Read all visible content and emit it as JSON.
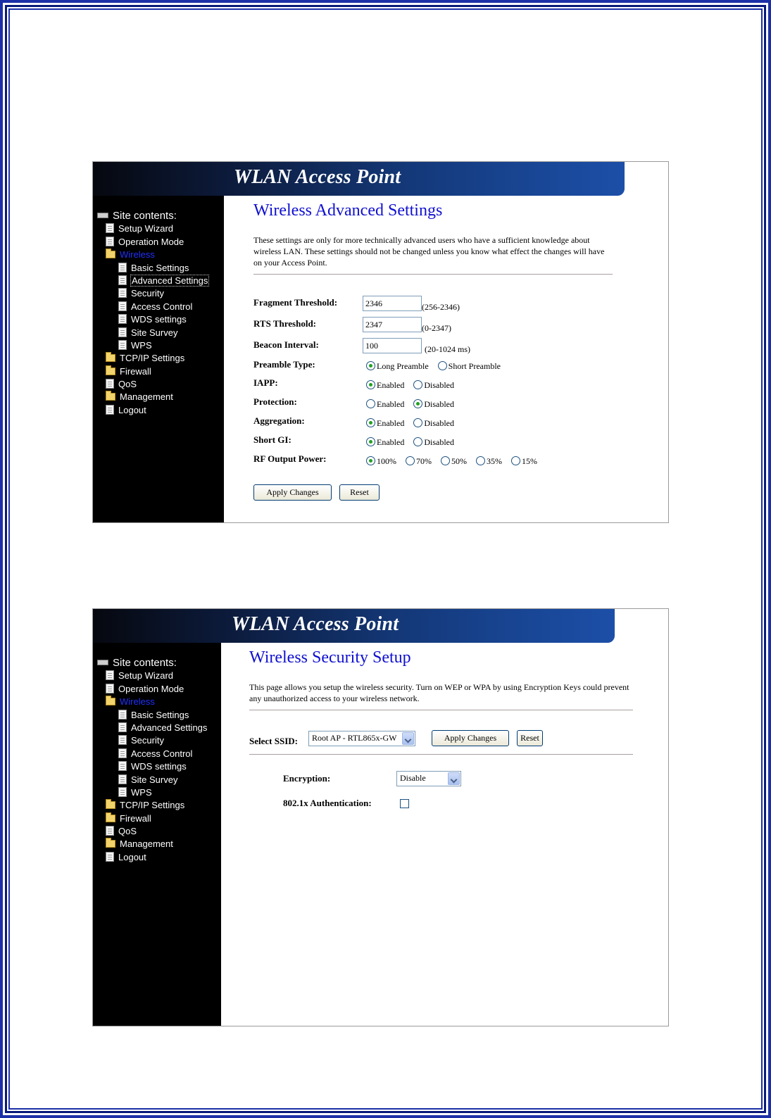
{
  "banner": {
    "title": "WLAN Access Point"
  },
  "sidebar": {
    "title": "Site contents:",
    "items": [
      {
        "label": "Setup Wizard",
        "icon": "document-icon",
        "level": 1
      },
      {
        "label": "Operation Mode",
        "icon": "document-icon",
        "level": 1
      },
      {
        "label": "Wireless",
        "icon": "open-folder-icon",
        "level": 1,
        "active": true
      },
      {
        "label": "Basic Settings",
        "icon": "document-icon",
        "level": 2
      },
      {
        "label": "Advanced Settings",
        "icon": "document-icon",
        "level": 2
      },
      {
        "label": "Security",
        "icon": "document-icon",
        "level": 2
      },
      {
        "label": "Access Control",
        "icon": "document-icon",
        "level": 2
      },
      {
        "label": "WDS settings",
        "icon": "document-icon",
        "level": 2
      },
      {
        "label": "Site Survey",
        "icon": "document-icon",
        "level": 2
      },
      {
        "label": "WPS",
        "icon": "document-icon",
        "level": 2
      },
      {
        "label": "TCP/IP Settings",
        "icon": "folder-icon",
        "level": 1
      },
      {
        "label": "Firewall",
        "icon": "folder-icon",
        "level": 1
      },
      {
        "label": "QoS",
        "icon": "document-icon",
        "level": 1
      },
      {
        "label": "Management",
        "icon": "folder-icon",
        "level": 1
      },
      {
        "label": "Logout",
        "icon": "document-icon",
        "level": 1
      }
    ]
  },
  "advanced": {
    "heading": "Wireless Advanced Settings",
    "description": "These settings are only for more technically advanced users who have a sufficient knowledge about wireless LAN. These settings should not be changed unless you know what effect the changes will have on your Access Point.",
    "fragment": {
      "label": "Fragment Threshold:",
      "value": "2346",
      "range": "(256-2346)"
    },
    "rts": {
      "label": "RTS Threshold:",
      "value": "2347",
      "range": "(0-2347)"
    },
    "beacon": {
      "label": "Beacon Interval:",
      "value": "100",
      "range": "(20-1024 ms)"
    },
    "preamble": {
      "label": "Preamble Type:",
      "options": [
        "Long Preamble",
        "Short Preamble"
      ],
      "selected": "Long Preamble"
    },
    "iapp": {
      "label": "IAPP:",
      "options": [
        "Enabled",
        "Disabled"
      ],
      "selected": "Enabled"
    },
    "protection": {
      "label": "Protection:",
      "options": [
        "Enabled",
        "Disabled"
      ],
      "selected": "Disabled"
    },
    "aggregation": {
      "label": "Aggregation:",
      "options": [
        "Enabled",
        "Disabled"
      ],
      "selected": "Enabled"
    },
    "shortgi": {
      "label": "Short GI:",
      "options": [
        "Enabled",
        "Disabled"
      ],
      "selected": "Enabled"
    },
    "rfpower": {
      "label": "RF Output Power:",
      "options": [
        "100%",
        "70%",
        "50%",
        "35%",
        "15%"
      ],
      "selected": "100%"
    },
    "apply_label": "Apply Changes",
    "reset_label": "Reset"
  },
  "security": {
    "heading": "Wireless Security Setup",
    "description": "This page allows you setup the wireless security. Turn on WEP or WPA by using Encryption Keys could prevent any unauthorized access to your wireless network.",
    "ssid_label": "Select SSID:",
    "ssid_value": "Root AP - RTL865x-GW",
    "apply_label": "Apply Changes",
    "reset_label": "Reset",
    "encryption_label": "Encryption:",
    "encryption_value": "Disable",
    "auth_label": "802.1x Authentication:",
    "auth_checked": false
  },
  "colors": {
    "frame": "#1b2fa6",
    "heading": "#1010d0",
    "active_link": "#2030ff",
    "radio_dot": "#21a121"
  }
}
